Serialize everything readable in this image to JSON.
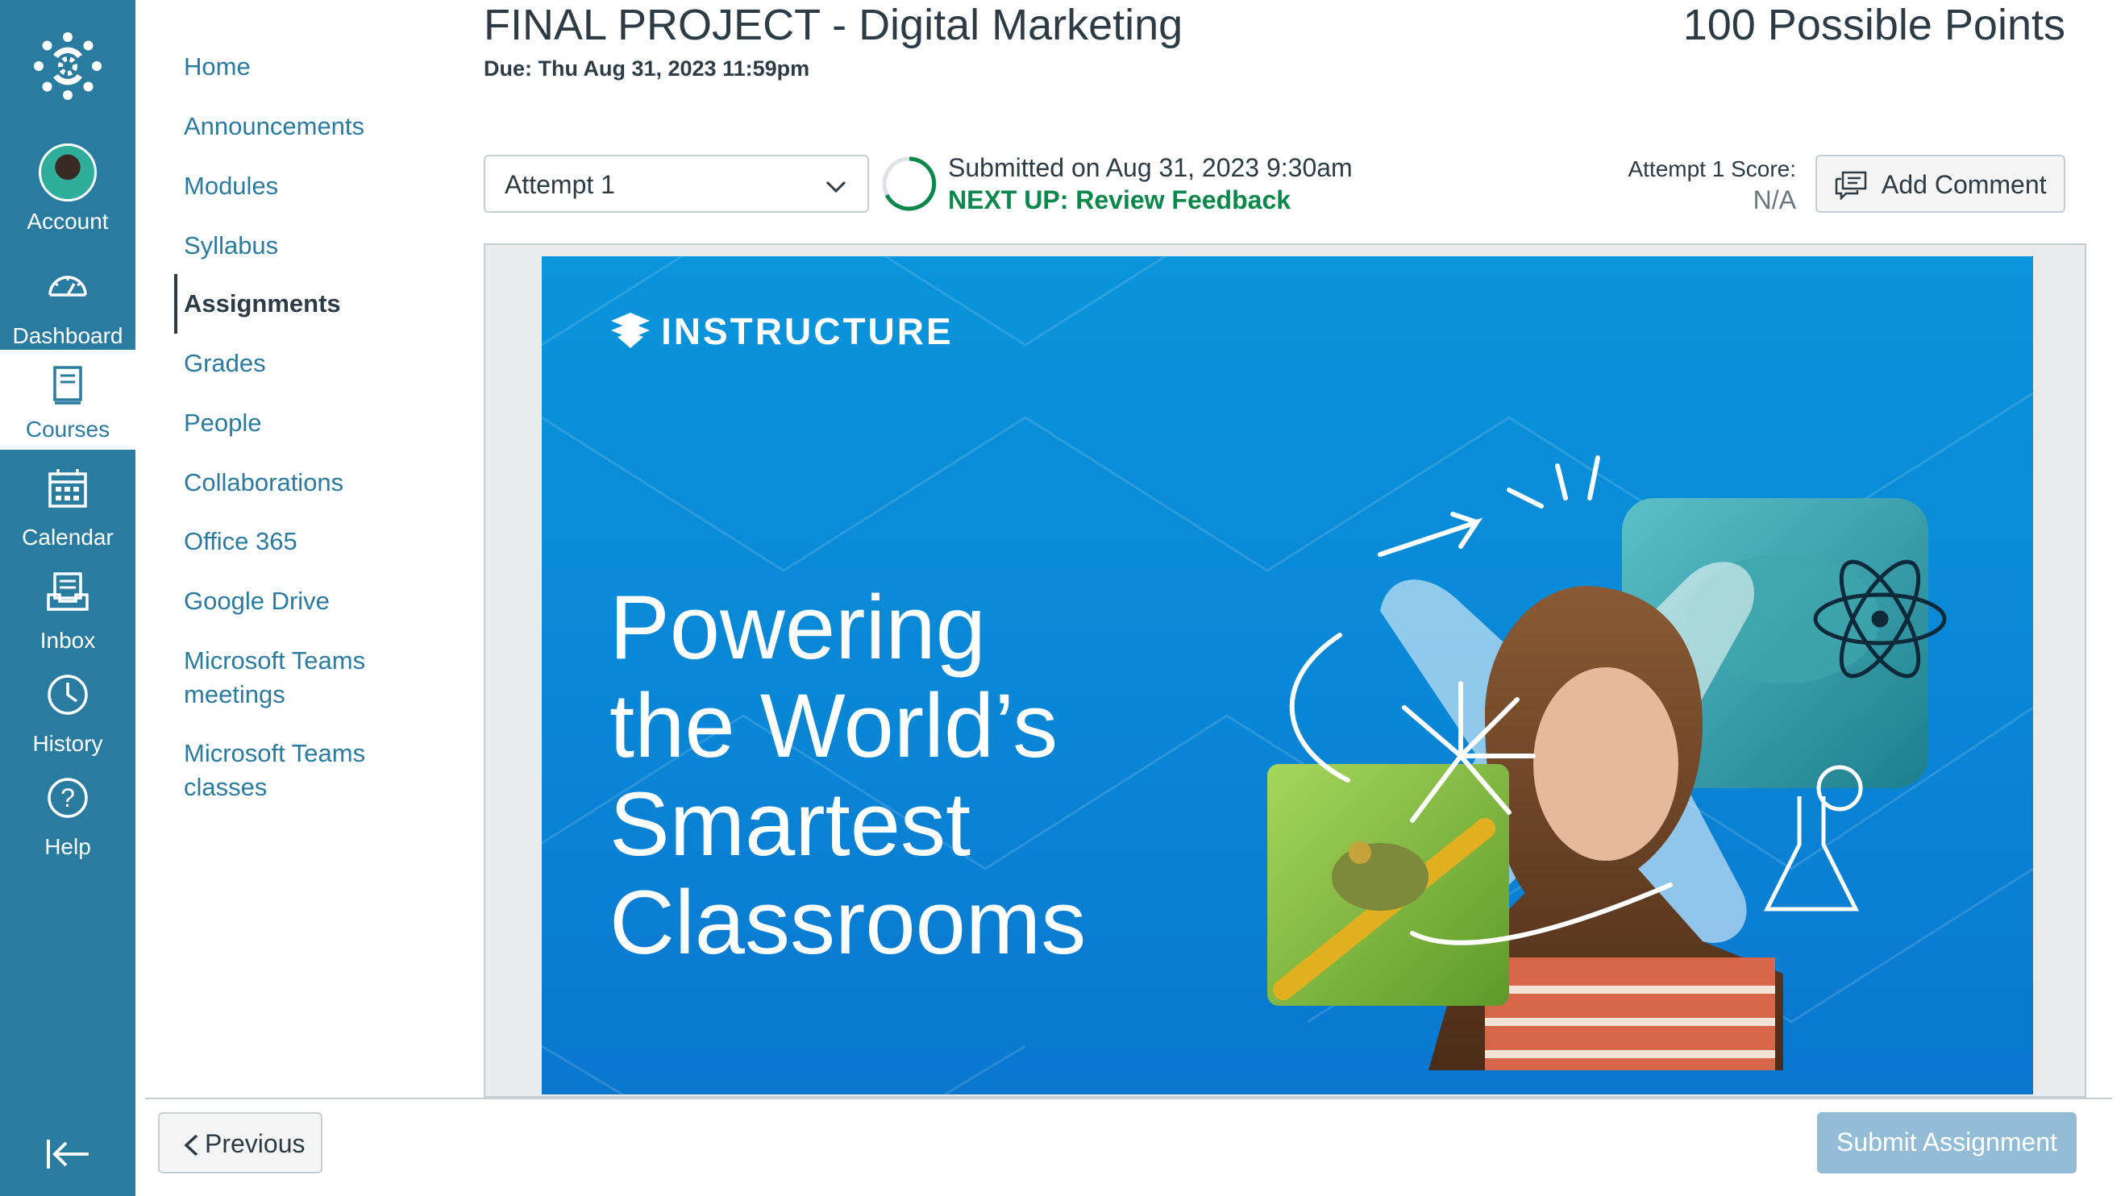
{
  "colors": {
    "global_nav_bg": "#2a7ba0",
    "link": "#2b7a9f",
    "text": "#2d3b45",
    "success": "#0b874b",
    "submit_disabled": "#93bdd6",
    "banner_blue": "#0a8ad6"
  },
  "global_nav": {
    "logo_icon": "canvas-logo-icon",
    "items": [
      {
        "label": "Account",
        "icon": "avatar"
      },
      {
        "label": "Dashboard",
        "icon": "dashboard-icon"
      },
      {
        "label": "Courses",
        "icon": "courses-icon"
      },
      {
        "label": "Calendar",
        "icon": "calendar-icon"
      },
      {
        "label": "Inbox",
        "icon": "inbox-icon"
      },
      {
        "label": "History",
        "icon": "clock-icon"
      },
      {
        "label": "Help",
        "icon": "help-icon"
      }
    ],
    "active": "Courses",
    "collapse_icon": "collapse-nav-icon"
  },
  "course_nav": {
    "items": [
      {
        "label": "Home"
      },
      {
        "label": "Announcements"
      },
      {
        "label": "Modules"
      },
      {
        "label": "Syllabus"
      },
      {
        "label": "Assignments"
      },
      {
        "label": "Grades"
      },
      {
        "label": "People"
      },
      {
        "label": "Collaborations"
      },
      {
        "label": "Office 365"
      },
      {
        "label": "Google Drive"
      },
      {
        "label": "Microsoft Teams meetings"
      },
      {
        "label": "Microsoft Teams classes"
      }
    ],
    "active": "Assignments"
  },
  "assignment": {
    "title": "FINAL PROJECT - Digital Marketing",
    "due": "Due: Thu Aug 31, 2023 11:59pm",
    "points": "100 Possible Points"
  },
  "submission": {
    "attempt_selected": "Attempt 1",
    "submitted_text": "Submitted on Aug 31, 2023 9:30am",
    "next_up": "NEXT UP: Review Feedback",
    "score_label": "Attempt 1 Score:",
    "score_value": "N/A",
    "add_comment": "Add Comment"
  },
  "preview": {
    "brand": "INSTRUCTURE",
    "headline": [
      "Powering",
      "the World’s",
      "Smartest",
      "Classrooms"
    ]
  },
  "footer": {
    "previous": "Previous",
    "submit": "Submit Assignment"
  }
}
